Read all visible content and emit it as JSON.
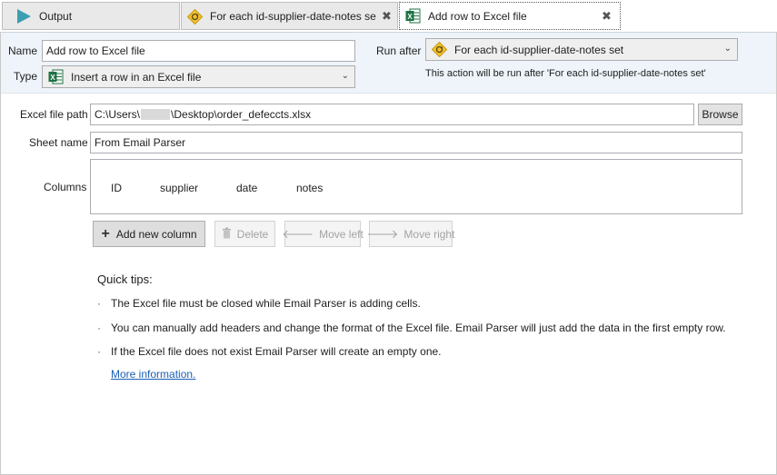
{
  "tabs": [
    {
      "title": "Output",
      "icon": "play-icon"
    },
    {
      "title": "For each id-supplier-date-notes se",
      "icon": "diamond-icon"
    },
    {
      "title": "Add row to Excel file",
      "icon": "excel-icon"
    }
  ],
  "header": {
    "name_label": "Name",
    "name_value": "Add row to Excel file",
    "type_label": "Type",
    "type_value": "Insert a row in an Excel file",
    "run_after_label": "Run after",
    "run_after_value": "For each id-supplier-date-notes set",
    "run_after_note": "This action will be run after 'For each id-supplier-date-notes set'"
  },
  "form": {
    "excel_path_label": "Excel file path",
    "excel_path_prefix": "C:\\Users\\",
    "excel_path_suffix": "\\Desktop\\order_defeccts.xlsx",
    "browse_label": "Browse",
    "sheet_label": "Sheet name",
    "sheet_value": "From Email Parser",
    "columns_label": "Columns",
    "columns": [
      "ID",
      "supplier",
      "date",
      "notes"
    ]
  },
  "buttons": {
    "add": "Add new column",
    "delete": "Delete",
    "move_left": "Move left",
    "move_right": "Move right"
  },
  "tips": {
    "title": "Quick tips:",
    "bullet": "·",
    "items": [
      "The Excel file must be closed while Email Parser is adding cells.",
      "You can manually add headers and change the format of the Excel file. Email Parser will just add the data in the first empty row.",
      "If the Excel file does not exist Email Parser will create an empty one."
    ],
    "link": "More information."
  },
  "colors": {
    "header_band": "#eef4fa",
    "excel_green": "#1e7145",
    "diamond_yellow": "#f2c12e",
    "play_teal": "#3a9fb3",
    "link_blue": "#1a5fb4"
  }
}
